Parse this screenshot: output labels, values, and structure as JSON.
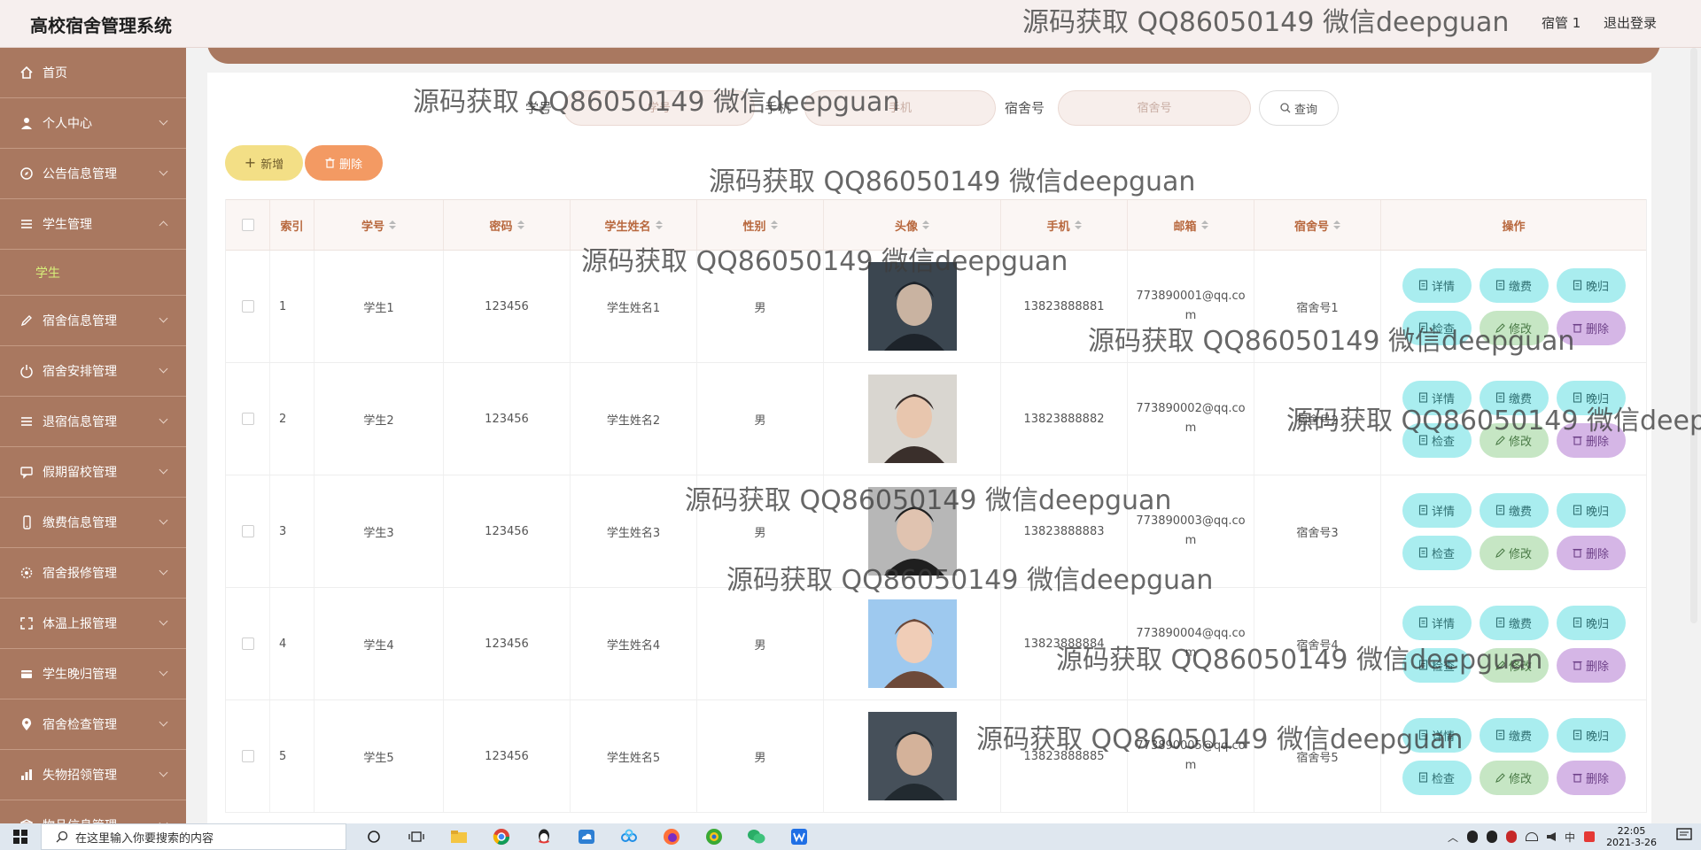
{
  "app": {
    "title": "高校宿舍管理系统",
    "user": "宿管 1",
    "logout": "退出登录"
  },
  "sidebar": {
    "items": [
      {
        "label": "首页",
        "icon": "home-icon"
      },
      {
        "label": "个人中心",
        "icon": "user-icon"
      },
      {
        "label": "公告信息管理",
        "icon": "compass-icon"
      },
      {
        "label": "学生管理",
        "icon": "sliders-icon",
        "expanded": true,
        "sub": [
          {
            "label": "学生"
          }
        ]
      },
      {
        "label": "宿舍信息管理",
        "icon": "edit-icon"
      },
      {
        "label": "宿舍安排管理",
        "icon": "power-icon"
      },
      {
        "label": "退宿信息管理",
        "icon": "list-icon"
      },
      {
        "label": "假期留校管理",
        "icon": "chat-icon"
      },
      {
        "label": "缴费信息管理",
        "icon": "phone-icon"
      },
      {
        "label": "宿舍报修管理",
        "icon": "settings-icon"
      },
      {
        "label": "体温上报管理",
        "icon": "fullscreen-icon"
      },
      {
        "label": "学生晚归管理",
        "icon": "card-icon"
      },
      {
        "label": "宿舍检查管理",
        "icon": "location-icon"
      },
      {
        "label": "失物招领管理",
        "icon": "chart-icon"
      },
      {
        "label": "物品信息管理",
        "icon": "box-icon"
      }
    ]
  },
  "search": {
    "fields": [
      {
        "label": "学号",
        "placeholder": "学号"
      },
      {
        "label": "手机",
        "placeholder": "手机"
      },
      {
        "label": "宿舍号",
        "placeholder": "宿舍号"
      }
    ],
    "query_button": "查询"
  },
  "toolbar": {
    "add": "新增",
    "delete": "删除"
  },
  "table": {
    "columns": [
      "索引",
      "学号",
      "密码",
      "学生姓名",
      "性别",
      "头像",
      "手机",
      "邮箱",
      "宿舍号",
      "操作"
    ],
    "rows": [
      {
        "index": "1",
        "student_no": "学生1",
        "password": "123456",
        "name": "学生姓名1",
        "gender": "男",
        "phone": "13823888881",
        "email": "773890001@qq.com",
        "dorm": "宿舍号1"
      },
      {
        "index": "2",
        "student_no": "学生2",
        "password": "123456",
        "name": "学生姓名2",
        "gender": "男",
        "phone": "13823888882",
        "email": "773890002@qq.com",
        "dorm": "宿舍号2"
      },
      {
        "index": "3",
        "student_no": "学生3",
        "password": "123456",
        "name": "学生姓名3",
        "gender": "男",
        "phone": "13823888883",
        "email": "773890003@qq.com",
        "dorm": "宿舍号3"
      },
      {
        "index": "4",
        "student_no": "学生4",
        "password": "123456",
        "name": "学生姓名4",
        "gender": "男",
        "phone": "13823888884",
        "email": "773890004@qq.com",
        "dorm": "宿舍号4"
      },
      {
        "index": "5",
        "student_no": "学生5",
        "password": "123456",
        "name": "学生姓名5",
        "gender": "男",
        "phone": "13823888885",
        "email": "773890005@qq.com",
        "dorm": "宿舍号5"
      }
    ],
    "actions": [
      "详情",
      "缴费",
      "晚归",
      "检查",
      "修改",
      "删除"
    ]
  },
  "watermark": "源码获取 QQ86050149 微信deepguan",
  "taskbar": {
    "search_placeholder": "在这里输入你要搜索的内容",
    "time": "22:05",
    "date": "2021-3-26",
    "ime": "中"
  }
}
